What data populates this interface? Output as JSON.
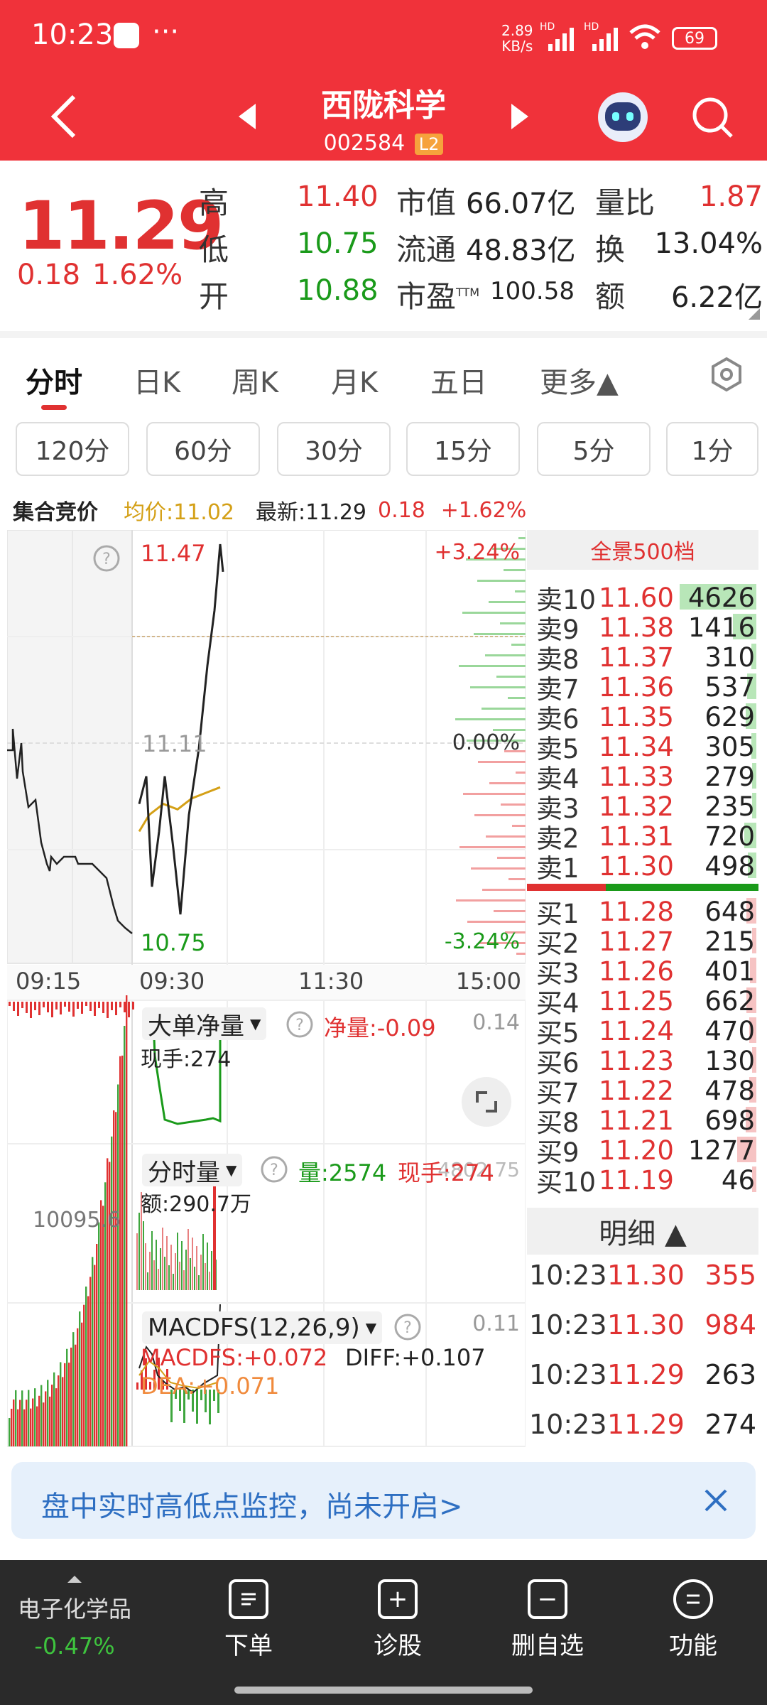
{
  "status": {
    "time": "10:23",
    "dots": "···",
    "speed_top": "2.89",
    "speed_bottom": "KB/s",
    "hd1": "HD",
    "hd2": "HD",
    "battery": "69"
  },
  "nav": {
    "name": "西陇科学",
    "code": "002584",
    "level": "L2"
  },
  "quote": {
    "price": "11.29",
    "change": "0.18",
    "pct": "1.62%",
    "high_label": "高",
    "high": "11.40",
    "low_label": "低",
    "low": "10.75",
    "open_label": "开",
    "open": "10.88",
    "mktcap_label": "市值",
    "mktcap": "66.07亿",
    "float_label": "流通",
    "float": "48.83亿",
    "pe_label": "市盈",
    "pe_tm": "TTM",
    "pe": "100.58",
    "volratio_label": "量比",
    "volratio": "1.87",
    "turnover_label": "换",
    "turnover": "13.04%",
    "amount_label": "额",
    "amount": "6.22亿"
  },
  "tabs": [
    "分时",
    "日K",
    "周K",
    "月K",
    "五日",
    "更多▲"
  ],
  "periods": [
    "120分",
    "60分",
    "30分",
    "15分",
    "5分",
    "1分"
  ],
  "infobar": {
    "auction": "集合竞价",
    "avg": "均价:11.02",
    "latest": "最新:11.29",
    "chg": "0.18",
    "pct": "+1.62%"
  },
  "chart": {
    "price_high": "11.47",
    "price_low": "10.75",
    "price_ref": "11.11",
    "pct_high": "+3.24%",
    "pct_zero": "0.00%",
    "pct_low": "-3.24%",
    "times": [
      "09:15",
      "09:30",
      "11:30",
      "15:00"
    ],
    "price_line": [
      11.0,
      11.05,
      10.85,
      10.95,
      11.05,
      10.92,
      10.8,
      10.98,
      11.1,
      11.25,
      11.35,
      11.47,
      11.42
    ],
    "avg_line": [
      10.95,
      10.98,
      11.0,
      10.99,
      11.01,
      11.02,
      11.03
    ]
  },
  "panel1": {
    "title": "大单净量",
    "value_label": "净量:",
    "value": "-0.09",
    "scale": "0.14",
    "hand": "现手:274"
  },
  "panel2": {
    "title": "分时量",
    "vol": "量:2574",
    "hand": "现手:274",
    "amount": "额:290.7万",
    "left_val": "10095.6",
    "right_val": "4802.75"
  },
  "panel3": {
    "title": "MACDFS(12,26,9)",
    "macd": "MACDFS:+0.072",
    "diff": "DIFF:+0.107",
    "dea": "DEA:+0.071",
    "scale": "0.11"
  },
  "orderbook": {
    "header": "全景500档",
    "asks": [
      {
        "label": "卖10",
        "price": "11.60",
        "vol": "4626"
      },
      {
        "label": "卖9",
        "price": "11.38",
        "vol": "1416"
      },
      {
        "label": "卖8",
        "price": "11.37",
        "vol": "310"
      },
      {
        "label": "卖7",
        "price": "11.36",
        "vol": "537"
      },
      {
        "label": "卖6",
        "price": "11.35",
        "vol": "629"
      },
      {
        "label": "卖5",
        "price": "11.34",
        "vol": "305"
      },
      {
        "label": "卖4",
        "price": "11.33",
        "vol": "279"
      },
      {
        "label": "卖3",
        "price": "11.32",
        "vol": "235"
      },
      {
        "label": "卖2",
        "price": "11.31",
        "vol": "720"
      },
      {
        "label": "卖1",
        "price": "11.30",
        "vol": "498"
      }
    ],
    "bids": [
      {
        "label": "买1",
        "price": "11.28",
        "vol": "648"
      },
      {
        "label": "买2",
        "price": "11.27",
        "vol": "215"
      },
      {
        "label": "买3",
        "price": "11.26",
        "vol": "401"
      },
      {
        "label": "买4",
        "price": "11.25",
        "vol": "662"
      },
      {
        "label": "买5",
        "price": "11.24",
        "vol": "470"
      },
      {
        "label": "买6",
        "price": "11.23",
        "vol": "130"
      },
      {
        "label": "买7",
        "price": "11.22",
        "vol": "478"
      },
      {
        "label": "买8",
        "price": "11.21",
        "vol": "698"
      },
      {
        "label": "买9",
        "price": "11.20",
        "vol": "1277"
      },
      {
        "label": "买10",
        "price": "11.19",
        "vol": "46"
      }
    ]
  },
  "detail": {
    "header": "明细 ▲",
    "rows": [
      {
        "time": "10:23",
        "price": "11.30",
        "vol": "355"
      },
      {
        "time": "10:23",
        "price": "11.30",
        "vol": "984"
      },
      {
        "time": "10:23",
        "price": "11.29",
        "vol": "263"
      },
      {
        "time": "10:23",
        "price": "11.29",
        "vol": "274"
      }
    ]
  },
  "banner": {
    "text": "盘中实时高低点监控，尚未开启>"
  },
  "bottom": {
    "sector": "电子化学品",
    "sector_pct": "-0.47%",
    "order": "下单",
    "diagnose": "诊股",
    "remove": "删自选",
    "func": "功能"
  },
  "colors": {
    "brand": "#f0323a",
    "up": "#e03131",
    "down": "#1a9a1a",
    "avg": "#d4a017"
  }
}
